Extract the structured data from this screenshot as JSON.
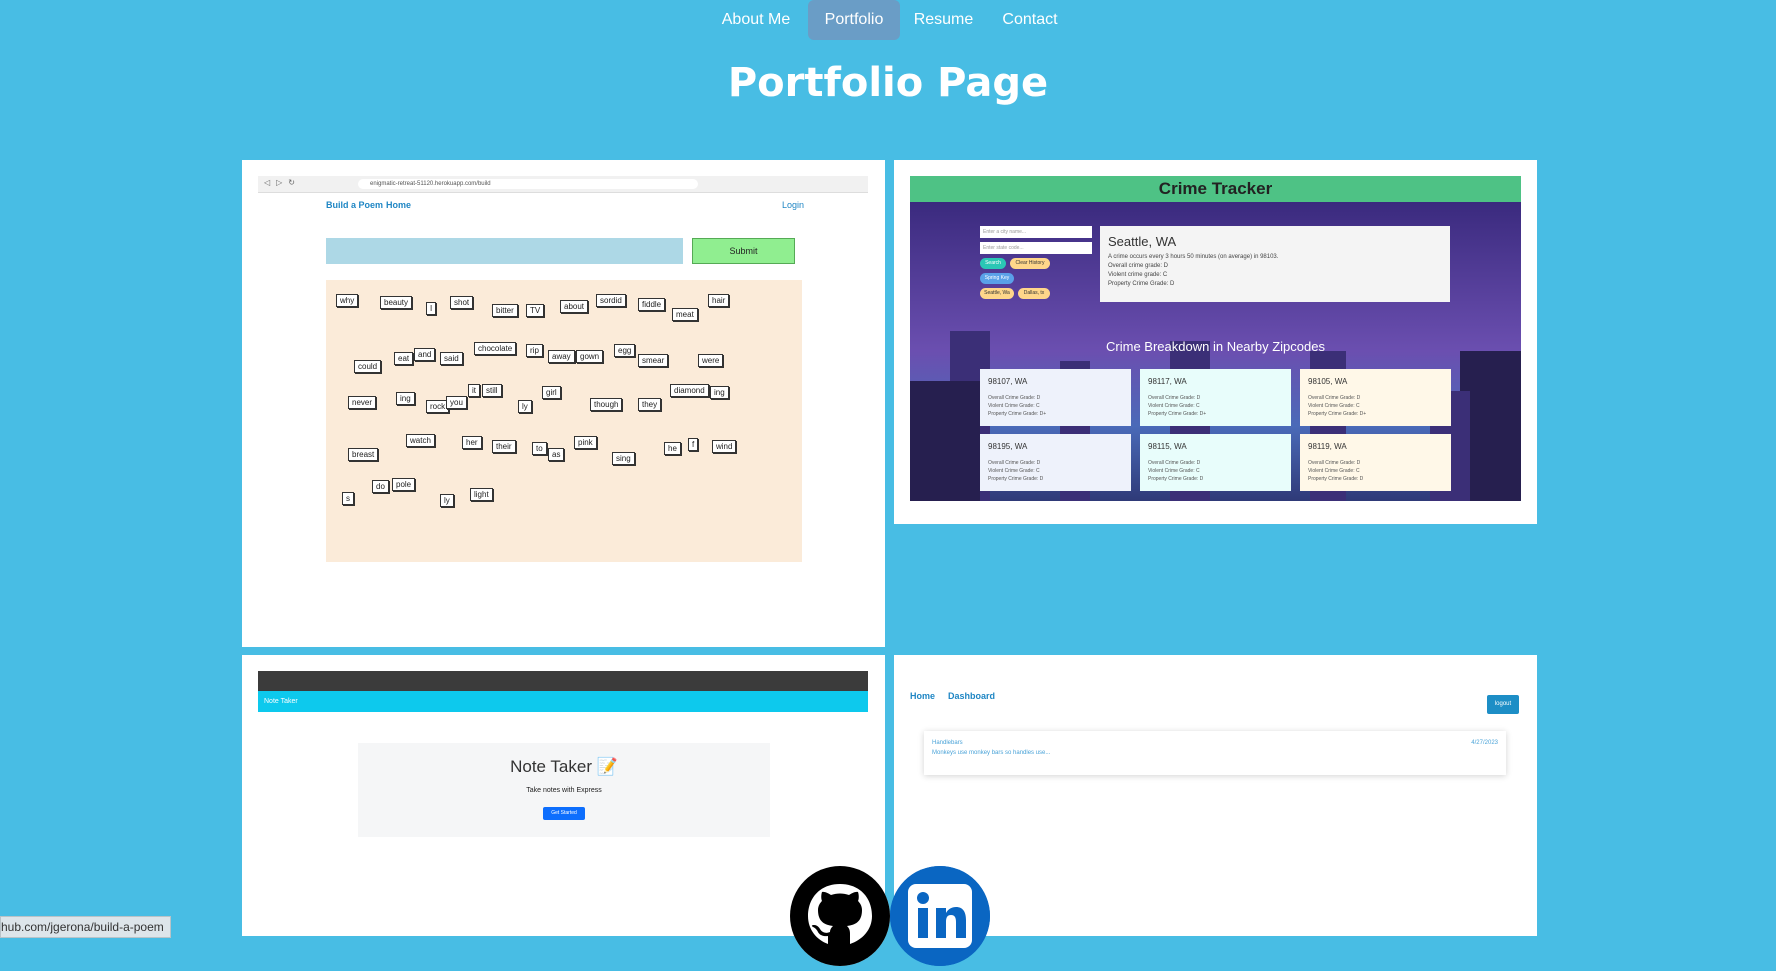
{
  "nav": {
    "items": [
      {
        "label": "About Me"
      },
      {
        "label": "Portfolio",
        "active": true
      },
      {
        "label": "Resume"
      },
      {
        "label": "Contact"
      }
    ]
  },
  "page_title": "Portfolio Page",
  "projects": {
    "poem": {
      "url": "enigmatic-retreat-51120.herokuapp.com/build",
      "brand": "Build a Poem",
      "home": "Home",
      "login": "Login",
      "submit": "Submit",
      "words": [
        "why",
        "beauty",
        "I",
        "shot",
        "bitter",
        "TV",
        "about",
        "sordid",
        "fiddle",
        "meat",
        "hair",
        "could",
        "eat",
        "and",
        "said",
        "chocolate",
        "rip",
        "away",
        "gown",
        "egg",
        "smear",
        "were",
        "never",
        "ing",
        "rock",
        "you",
        "it",
        "still",
        "ly",
        "girl",
        "though",
        "they",
        "diamond",
        "ing",
        "breast",
        "watch",
        "her",
        "their",
        "to",
        "as",
        "pink",
        "sing",
        "he",
        "f",
        "wind",
        "s",
        "do",
        "pole",
        "ly",
        "light"
      ]
    },
    "crime": {
      "title": "Crime Tracker",
      "city_placeholder": "Enter a city name...",
      "zip_placeholder": "Enter state code...",
      "buttons": [
        "Search",
        "Clear History",
        "Spring Key",
        "Seattle, Wa",
        "Dallas, tx"
      ],
      "city": "Seattle, WA",
      "lines": [
        "A crime occurs every 3 hours 50 minutes (on average) in 98103.",
        "Overall crime grade: D",
        "Violent crime grade: C",
        "Property Crime Grade: D"
      ],
      "breakdown_title": "Crime Breakdown in Nearby Zipcodes",
      "zips": [
        {
          "zip": "98107, WA",
          "overall": "Overall Crime Grade: D",
          "violent": "Violent Crime Grade: C",
          "property": "Property Crime Grade: D+"
        },
        {
          "zip": "98117, WA",
          "overall": "Overall Crime Grade: D",
          "violent": "Violent Crime Grade: C",
          "property": "Property Crime Grade: D+"
        },
        {
          "zip": "98105, WA",
          "overall": "Overall Crime Grade: D",
          "violent": "Violent Crime Grade: C",
          "property": "Property Crime Grade: D+"
        },
        {
          "zip": "98195, WA",
          "overall": "Overall Crime Grade: D",
          "violent": "Violent Crime Grade: C",
          "property": "Property Crime Grade: D"
        },
        {
          "zip": "98115, WA",
          "overall": "Overall Crime Grade: D",
          "violent": "Violent Crime Grade: C",
          "property": "Property Crime Grade: D"
        },
        {
          "zip": "98119, WA",
          "overall": "Overall Crime Grade: D",
          "violent": "Violent Crime Grade: C",
          "property": "Property Crime Grade: D"
        }
      ],
      "zip_colors": [
        "#eef2fb",
        "#e8fdfb",
        "#fff8e8",
        "#eef2fb",
        "#e8fdfb",
        "#fff8e8"
      ]
    },
    "note": {
      "bar": "Note Taker",
      "title": "Note Taker",
      "subtitle": "Take notes with Express",
      "button": "Get Started"
    },
    "dash": {
      "home": "Home",
      "dashboard": "Dashboard",
      "logout": "logout",
      "post_title": "Handlebars",
      "post_body": "Monkeys use monkey bars so handles use...",
      "post_date": "4/27/2023"
    }
  },
  "social": {
    "github": "github-icon",
    "linkedin": "linkedin-icon"
  },
  "status_url": "hub.com/jgerona/build-a-poem",
  "colors": {
    "background": "#48bde4",
    "nav_active": "#6a9dc6"
  }
}
